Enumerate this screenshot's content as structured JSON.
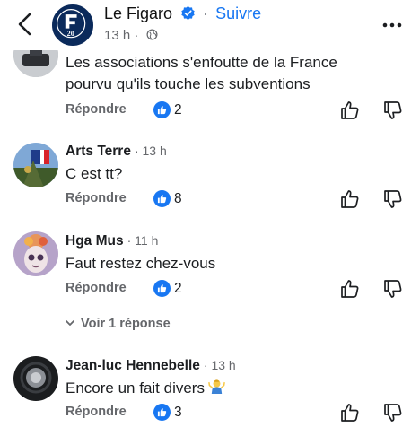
{
  "header": {
    "page_name": "Le Figaro",
    "follow_label": "Suivre",
    "timestamp": "13 h",
    "avatar_text": "20",
    "back_icon": "chevron-left-icon",
    "more_icon": "more-horizontal-icon",
    "verified_icon": "verified-badge-icon",
    "audience_icon": "globe-icon"
  },
  "colors": {
    "accent": "#1877f2",
    "secondary_text": "#65676b",
    "avatar_bg": "#0b2a5b"
  },
  "comments": [
    {
      "author": "",
      "time": "",
      "text_lines": [
        "Les associations s'enfoutte de la France",
        "pourvu qu'ils touche les subventions"
      ],
      "reply_label": "Répondre",
      "likes": "2"
    },
    {
      "author": "Arts Terre",
      "time": "· 13 h",
      "text_lines": [
        "C est tt?"
      ],
      "reply_label": "Répondre",
      "likes": "8"
    },
    {
      "author": "Hga Mus",
      "time": "· 11 h",
      "text_lines": [
        "Faut restez chez-vous"
      ],
      "reply_label": "Répondre",
      "likes": "2",
      "view_replies": "Voir 1 réponse"
    },
    {
      "author": "Jean-luc Hennebelle",
      "time": "· 13 h",
      "text_lines": [
        "Encore un fait divers"
      ],
      "emoji": "person-shrugging-emoji",
      "reply_label": "Répondre",
      "likes": "3"
    }
  ]
}
